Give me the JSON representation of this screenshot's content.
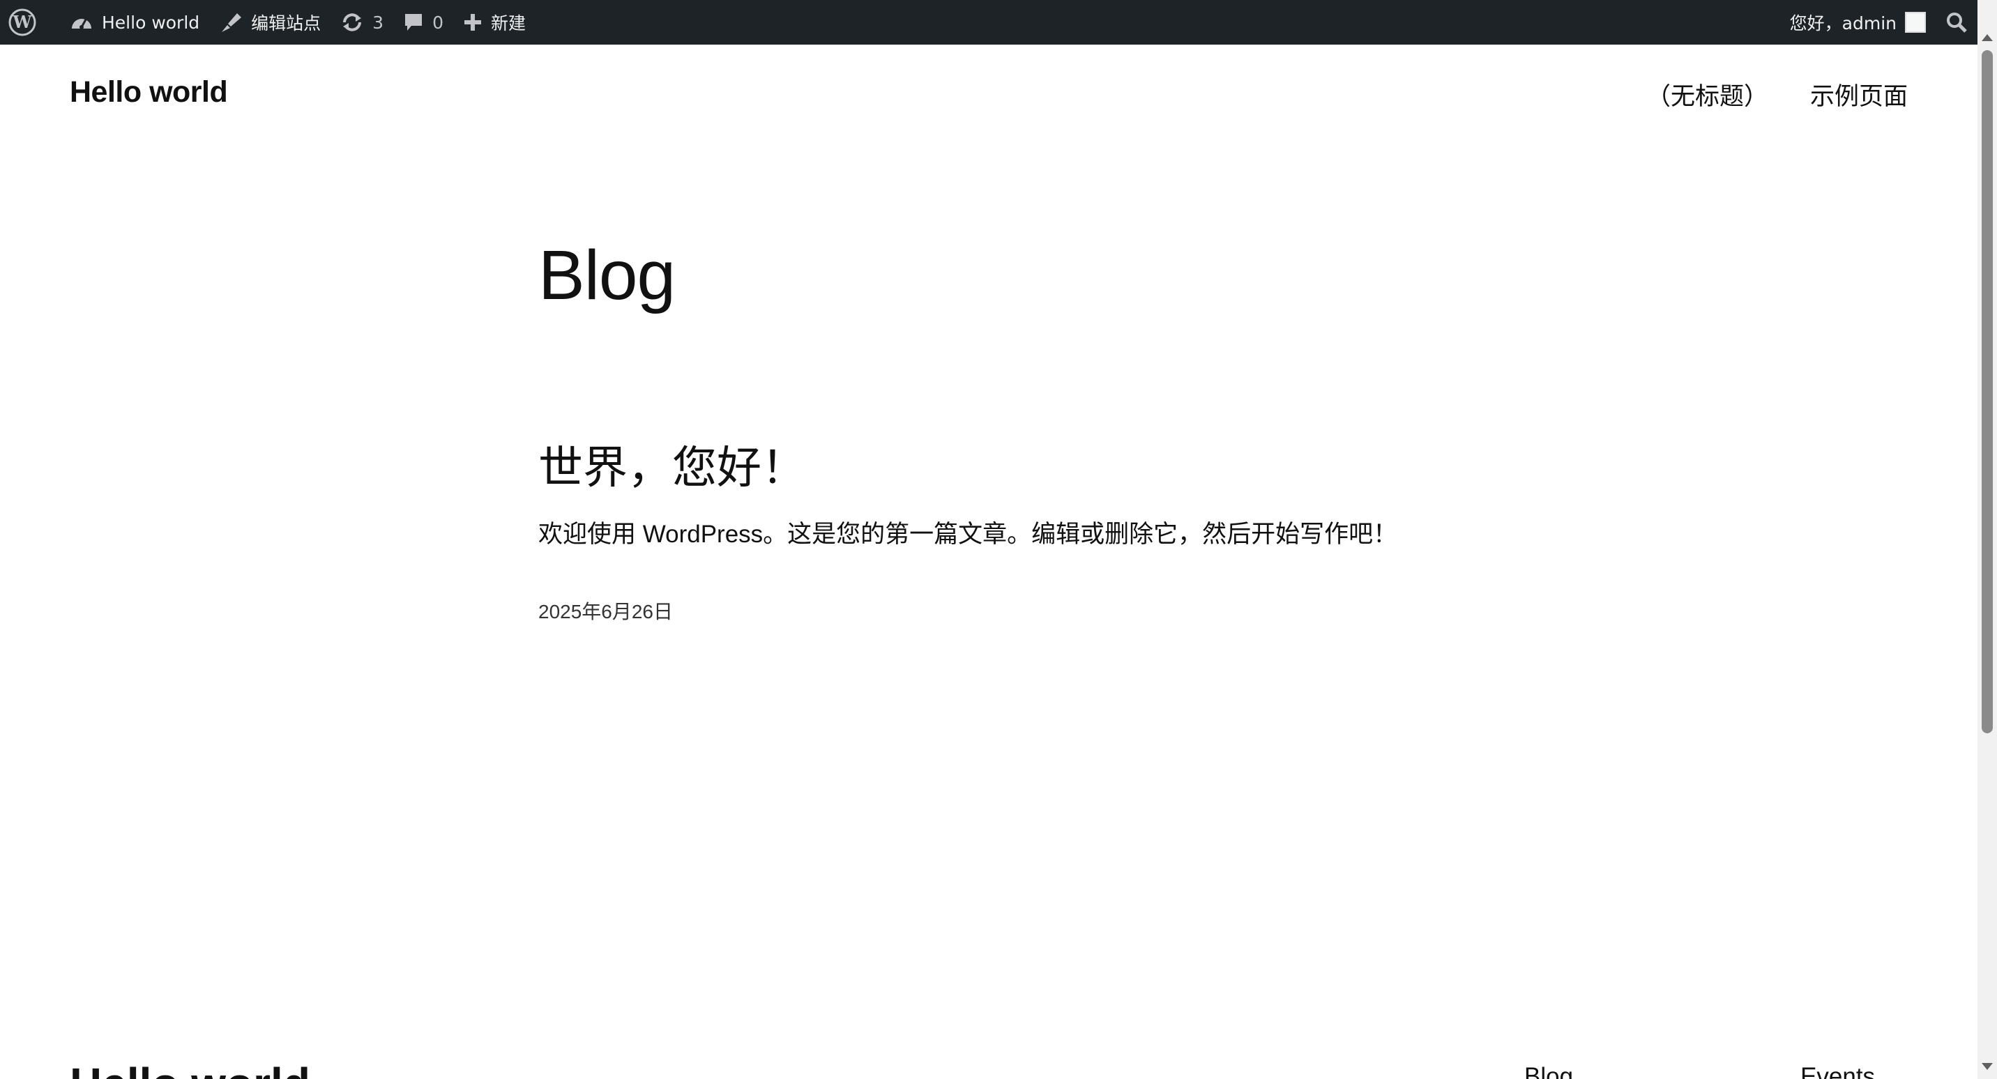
{
  "adminbar": {
    "site_name": "Hello world",
    "edit_site": "编辑站点",
    "updates_count": "3",
    "comments_count": "0",
    "new_label": "新建",
    "greeting": "您好，admin"
  },
  "header": {
    "site_title": "Hello world",
    "nav": [
      "（无标题）",
      "示例页面"
    ]
  },
  "main": {
    "page_heading": "Blog",
    "post": {
      "title": "世界，您好！",
      "excerpt": "欢迎使用 WordPress。这是您的第一篇文章。编辑或删除它，然后开始写作吧！",
      "date": "2025年6月26日"
    }
  },
  "footer": {
    "site_title": "Hello world",
    "nav": [
      "Blog",
      "Events"
    ]
  },
  "colors": {
    "adminbar_bg": "#1d2327",
    "adminbar_text": "#f0f0f1",
    "page_bg": "#ffffff",
    "text": "#111111"
  }
}
